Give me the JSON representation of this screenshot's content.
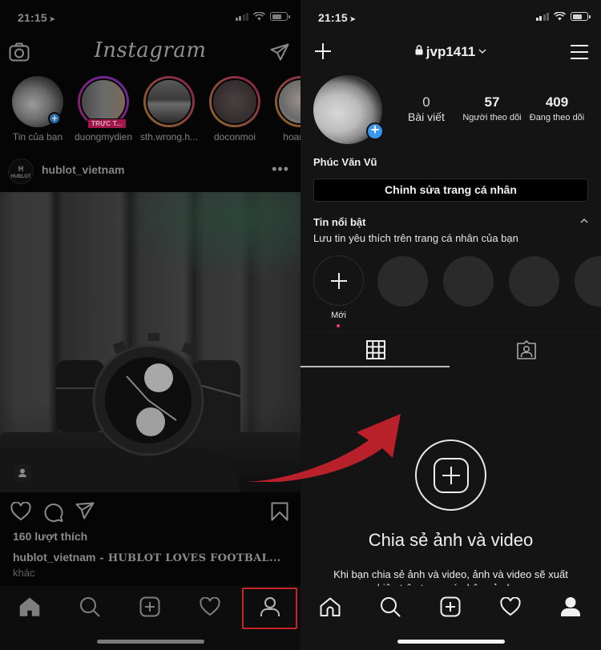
{
  "left": {
    "status": {
      "time": "21:15",
      "location_icon": "location-arrow-icon",
      "signal_bars": 4,
      "signal_filled": 2
    },
    "header": {
      "logo": "Instagram",
      "left_icon": "camera-icon",
      "right_icon": "direct-message-icon"
    },
    "stories": [
      {
        "name": "Tin của bạn",
        "own": true,
        "badge": "+"
      },
      {
        "name": "duongmydien",
        "live_label": "TRỰC T..."
      },
      {
        "name": "sth.wrong.h..."
      },
      {
        "name": "doconmoi"
      },
      {
        "name": "hoangth"
      }
    ],
    "post": {
      "account": "hublot_vietnam",
      "avatar_text": "HUBLOT",
      "more_icon": "more-horizontal-icon",
      "image_alt": "Hublot chronograph watch in stadium seats",
      "likes": "160 lượt thích",
      "caption_user": "hublot_vietnam",
      "caption_text": " - HUBLOT LOVES FOOTBAL...",
      "more_label": "khác"
    },
    "tabbar": [
      "home",
      "search",
      "new-post",
      "activity",
      "profile"
    ],
    "highlighted_tab": "profile"
  },
  "right": {
    "status": {
      "time": "21:15"
    },
    "header": {
      "username": "jvp1411",
      "private": true
    },
    "profile": {
      "display_name": "Phúc Văn Vũ",
      "stats": [
        {
          "value": "0",
          "label": "Bài viết"
        },
        {
          "value": "57",
          "label": "Người theo dõi"
        },
        {
          "value": "409",
          "label": "Đang theo dõi"
        }
      ],
      "edit_button": "Chỉnh sửa trang cá nhân"
    },
    "highlights": {
      "title": "Tin nổi bật",
      "subtitle": "Lưu tin yêu thích trên trang cá nhân của bạn",
      "new_label": "Mới"
    },
    "tabs": [
      {
        "name": "grid",
        "active": true
      },
      {
        "name": "tagged",
        "active": false
      }
    ],
    "empty_state": {
      "title": "Chia sẻ ảnh và video",
      "subtitle": "Khi bạn chia sẻ ảnh và video, ảnh và video sẽ xuất hiện trên trang cá nhân của bạn"
    },
    "tabbar": [
      "home",
      "search",
      "new-post",
      "activity",
      "profile"
    ],
    "active_tab": "profile"
  },
  "annotation": {
    "type": "arrow",
    "color": "#c8242a",
    "from": "left-profile-tab",
    "to": "right-profile-screen"
  }
}
